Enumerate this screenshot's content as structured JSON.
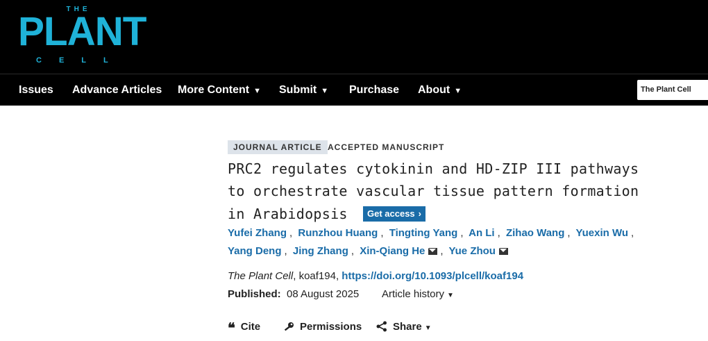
{
  "logo": {
    "the": "THE",
    "plant": "PLANT",
    "cell": "CELL"
  },
  "nav": {
    "items": [
      {
        "label": "Issues",
        "dropdown": false
      },
      {
        "label": "Advance Articles",
        "dropdown": false
      },
      {
        "label": "More Content",
        "dropdown": true
      },
      {
        "label": "Submit",
        "dropdown": true
      },
      {
        "label": "Purchase",
        "dropdown": false
      },
      {
        "label": "About",
        "dropdown": true
      }
    ],
    "search_scope": "The Plant Cell"
  },
  "article": {
    "type_badge": "JOURNAL ARTICLE",
    "status_badge": "ACCEPTED MANUSCRIPT",
    "title_lines": [
      "PRC2 regulates cytokinin and HD-ZIP III pathways",
      "to orchestrate vascular tissue pattern formation",
      "in Arabidopsis"
    ],
    "get_access_label": "Get access",
    "authors_line1": [
      "Yufei Zhang",
      "Runzhou Huang",
      "Tingting Yang",
      "An Li",
      "Zihao Wang",
      "Yuexin Wu"
    ],
    "authors_line2": [
      "Yang Deng",
      "Jing Zhang",
      "Xin-Qiang He",
      "Yue Zhou"
    ],
    "journal_name": "The Plant Cell",
    "article_id": "koaf194",
    "doi": "https://doi.org/10.1093/plcell/koaf194",
    "published_label": "Published:",
    "published_date": "08 August 2025",
    "article_history_label": "Article history"
  },
  "tools": {
    "cite": "Cite",
    "permissions": "Permissions",
    "share": "Share"
  },
  "colors": {
    "brand": "#1fb2d8",
    "link": "#1a6ca8",
    "header_bg": "#000000"
  }
}
